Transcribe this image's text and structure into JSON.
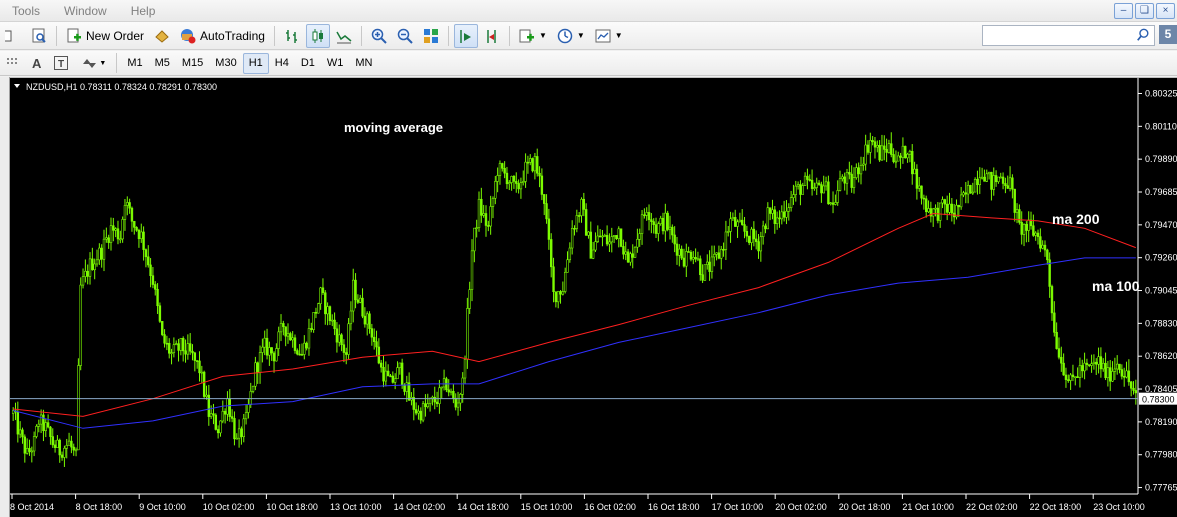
{
  "menu": {
    "items": [
      "Tools",
      "Window",
      "Help"
    ]
  },
  "toolbar": {
    "new_order_label": "New Order",
    "autotrading_label": "AutoTrading",
    "search_placeholder": "",
    "badge": "5"
  },
  "timeframes": [
    "M1",
    "M5",
    "M15",
    "M30",
    "H1",
    "H4",
    "D1",
    "W1",
    "MN"
  ],
  "active_timeframe": "H1",
  "chart": {
    "header": "NZDUSD,H1  0.78311 0.78324 0.78291 0.78300",
    "annotations": {
      "title": "moving average",
      "ma200": "ma 200",
      "ma100": "ma 100"
    },
    "current_price_label": "0.78300",
    "colors": {
      "background": "#000000",
      "candle": "#7cfc00",
      "ma200": "#ff2020",
      "ma100": "#3030ff",
      "price_line": "#8aa8c8",
      "text": "#ffffff"
    }
  },
  "chart_data": {
    "type": "candlestick",
    "symbol": "NZDUSD",
    "timeframe": "H1",
    "ylim": [
      0.7767,
      0.8037
    ],
    "y_ticks": [
      "0.80325",
      "0.80110",
      "0.79890",
      "0.79685",
      "0.79470",
      "0.79260",
      "0.79045",
      "0.78830",
      "0.78620",
      "0.78405",
      "0.78190",
      "0.77980",
      "0.77765"
    ],
    "x_ticks": [
      "8 Oct 2014",
      "8 Oct 18:00",
      "9 Oct 10:00",
      "10 Oct 02:00",
      "10 Oct 18:00",
      "13 Oct 10:00",
      "14 Oct 02:00",
      "14 Oct 18:00",
      "15 Oct 10:00",
      "16 Oct 02:00",
      "16 Oct 18:00",
      "17 Oct 10:00",
      "20 Oct 02:00",
      "20 Oct 18:00",
      "21 Oct 10:00",
      "22 Oct 02:00",
      "22 Oct 18:00",
      "23 Oct 10:00"
    ],
    "current_price": 0.783,
    "close_path": [
      [
        0,
        0.782
      ],
      [
        3,
        0.7805
      ],
      [
        6,
        0.7792
      ],
      [
        9,
        0.78
      ],
      [
        11,
        0.7815
      ],
      [
        14,
        0.781
      ],
      [
        17,
        0.78
      ],
      [
        20,
        0.7795
      ],
      [
        24,
        0.78
      ],
      [
        27,
        0.779
      ],
      [
        29,
        0.7905
      ],
      [
        33,
        0.792
      ],
      [
        38,
        0.793
      ],
      [
        42,
        0.7945
      ],
      [
        46,
        0.794
      ],
      [
        48,
        0.7965
      ],
      [
        51,
        0.795
      ],
      [
        55,
        0.794
      ],
      [
        60,
        0.791
      ],
      [
        64,
        0.787
      ],
      [
        68,
        0.786
      ],
      [
        72,
        0.7865
      ],
      [
        76,
        0.786
      ],
      [
        80,
        0.785
      ],
      [
        84,
        0.782
      ],
      [
        88,
        0.781
      ],
      [
        92,
        0.783
      ],
      [
        96,
        0.78
      ],
      [
        100,
        0.7815
      ],
      [
        104,
        0.785
      ],
      [
        108,
        0.7865
      ],
      [
        112,
        0.786
      ],
      [
        116,
        0.788
      ],
      [
        120,
        0.787
      ],
      [
        124,
        0.786
      ],
      [
        128,
        0.788
      ],
      [
        132,
        0.79
      ],
      [
        136,
        0.7885
      ],
      [
        140,
        0.787
      ],
      [
        143,
        0.786
      ],
      [
        146,
        0.7905
      ],
      [
        150,
        0.789
      ],
      [
        154,
        0.7875
      ],
      [
        158,
        0.785
      ],
      [
        162,
        0.784
      ],
      [
        166,
        0.785
      ],
      [
        170,
        0.783
      ],
      [
        174,
        0.782
      ],
      [
        178,
        0.7825
      ],
      [
        182,
        0.783
      ],
      [
        186,
        0.784
      ],
      [
        190,
        0.7825
      ],
      [
        193,
        0.784
      ],
      [
        197,
        0.793
      ],
      [
        200,
        0.796
      ],
      [
        204,
        0.7945
      ],
      [
        208,
        0.7985
      ],
      [
        212,
        0.798
      ],
      [
        216,
        0.797
      ],
      [
        220,
        0.7985
      ],
      [
        224,
        0.799
      ],
      [
        228,
        0.7965
      ],
      [
        232,
        0.79
      ],
      [
        236,
        0.7905
      ],
      [
        240,
        0.7945
      ],
      [
        244,
        0.796
      ],
      [
        248,
        0.793
      ],
      [
        252,
        0.794
      ],
      [
        256,
        0.7935
      ],
      [
        260,
        0.7945
      ],
      [
        264,
        0.792
      ],
      [
        268,
        0.794
      ],
      [
        272,
        0.796
      ],
      [
        276,
        0.7945
      ],
      [
        280,
        0.795
      ],
      [
        284,
        0.7935
      ],
      [
        288,
        0.7925
      ],
      [
        292,
        0.793
      ],
      [
        296,
        0.7915
      ],
      [
        300,
        0.792
      ],
      [
        304,
        0.793
      ],
      [
        308,
        0.795
      ],
      [
        312,
        0.7945
      ],
      [
        316,
        0.794
      ],
      [
        320,
        0.7935
      ],
      [
        324,
        0.7955
      ],
      [
        328,
        0.795
      ],
      [
        332,
        0.796
      ],
      [
        336,
        0.797
      ],
      [
        340,
        0.7975
      ],
      [
        344,
        0.797
      ],
      [
        348,
        0.7975
      ],
      [
        352,
        0.796
      ],
      [
        356,
        0.798
      ],
      [
        360,
        0.7975
      ],
      [
        364,
        0.799
      ],
      [
        368,
        0.8005
      ],
      [
        372,
        0.7995
      ],
      [
        376,
        0.8
      ],
      [
        380,
        0.799
      ],
      [
        384,
        0.8
      ],
      [
        388,
        0.7975
      ],
      [
        392,
        0.796
      ],
      [
        396,
        0.7955
      ],
      [
        400,
        0.796
      ],
      [
        404,
        0.7955
      ],
      [
        408,
        0.7965
      ],
      [
        412,
        0.7975
      ],
      [
        416,
        0.7985
      ],
      [
        420,
        0.7975
      ],
      [
        424,
        0.798
      ],
      [
        428,
        0.7975
      ],
      [
        432,
        0.7945
      ],
      [
        436,
        0.7945
      ],
      [
        440,
        0.794
      ],
      [
        444,
        0.7925
      ],
      [
        447,
        0.7875
      ],
      [
        450,
        0.7855
      ],
      [
        454,
        0.784
      ],
      [
        458,
        0.785
      ],
      [
        462,
        0.785
      ],
      [
        466,
        0.7855
      ],
      [
        470,
        0.7845
      ],
      [
        474,
        0.7855
      ],
      [
        478,
        0.7845
      ],
      [
        482,
        0.783
      ]
    ],
    "series": [
      {
        "name": "ma 200",
        "points": [
          [
            0,
            0.7823
          ],
          [
            30,
            0.7818
          ],
          [
            60,
            0.783
          ],
          [
            90,
            0.7845
          ],
          [
            120,
            0.785
          ],
          [
            150,
            0.7858
          ],
          [
            180,
            0.7862
          ],
          [
            200,
            0.7855
          ],
          [
            230,
            0.7868
          ],
          [
            260,
            0.788
          ],
          [
            290,
            0.7893
          ],
          [
            320,
            0.7905
          ],
          [
            350,
            0.7922
          ],
          [
            380,
            0.7945
          ],
          [
            395,
            0.7955
          ],
          [
            420,
            0.7952
          ],
          [
            440,
            0.795
          ],
          [
            460,
            0.7945
          ],
          [
            482,
            0.7932
          ]
        ]
      },
      {
        "name": "ma 100",
        "points": [
          [
            0,
            0.7822
          ],
          [
            30,
            0.781
          ],
          [
            60,
            0.7815
          ],
          [
            90,
            0.7825
          ],
          [
            120,
            0.7828
          ],
          [
            150,
            0.7838
          ],
          [
            180,
            0.784
          ],
          [
            200,
            0.784
          ],
          [
            230,
            0.7855
          ],
          [
            260,
            0.7868
          ],
          [
            290,
            0.7878
          ],
          [
            320,
            0.7888
          ],
          [
            350,
            0.79
          ],
          [
            380,
            0.7908
          ],
          [
            410,
            0.7912
          ],
          [
            440,
            0.792
          ],
          [
            460,
            0.7925
          ],
          [
            482,
            0.7925
          ]
        ]
      }
    ],
    "bar_count": 483
  }
}
